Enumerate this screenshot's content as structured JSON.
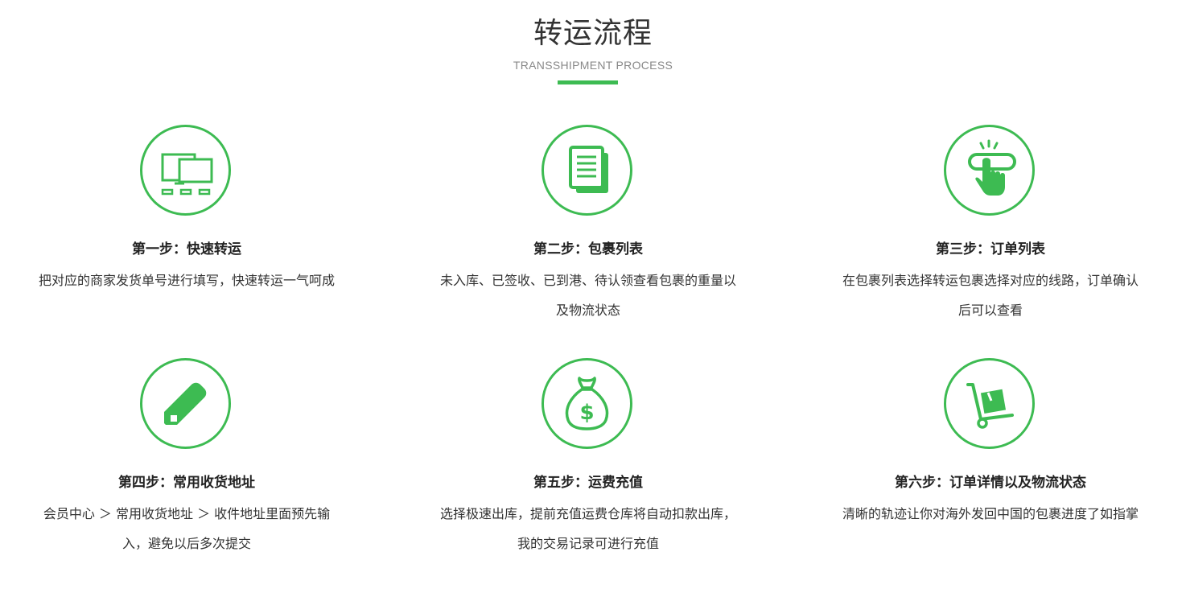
{
  "header": {
    "title": "转运流程",
    "subtitle": "TRANSSHIPMENT PROCESS"
  },
  "accent_color": "#3dbb52",
  "steps": [
    {
      "title": "第一步：快速转运",
      "description": "把对应的商家发货单号进行填写，快速转运一气呵成",
      "icon": "devices-icon"
    },
    {
      "title": "第二步：包裹列表",
      "description": "未入库、已签收、已到港、待认领查看包裹的重量以及物流状态",
      "icon": "documents-icon"
    },
    {
      "title": "第三步：订单列表",
      "description": "在包裹列表选择转运包裹选择对应的线路，订单确认后可以查看",
      "icon": "hand-click-icon"
    },
    {
      "title": "第四步：常用收货地址",
      "description": "会员中心 ＞ 常用收货地址 ＞ 收件地址里面预先输入，避免以后多次提交",
      "icon": "pencil-icon"
    },
    {
      "title": "第五步：运费充值",
      "description": "选择极速出库，提前充值运费仓库将自动扣款出库，我的交易记录可进行充值",
      "icon": "money-bag-icon"
    },
    {
      "title": "第六步：订单详情以及物流状态",
      "description": "清晰的轨迹让你对海外发回中国的包裹进度了如指掌",
      "icon": "hand-truck-icon"
    }
  ]
}
